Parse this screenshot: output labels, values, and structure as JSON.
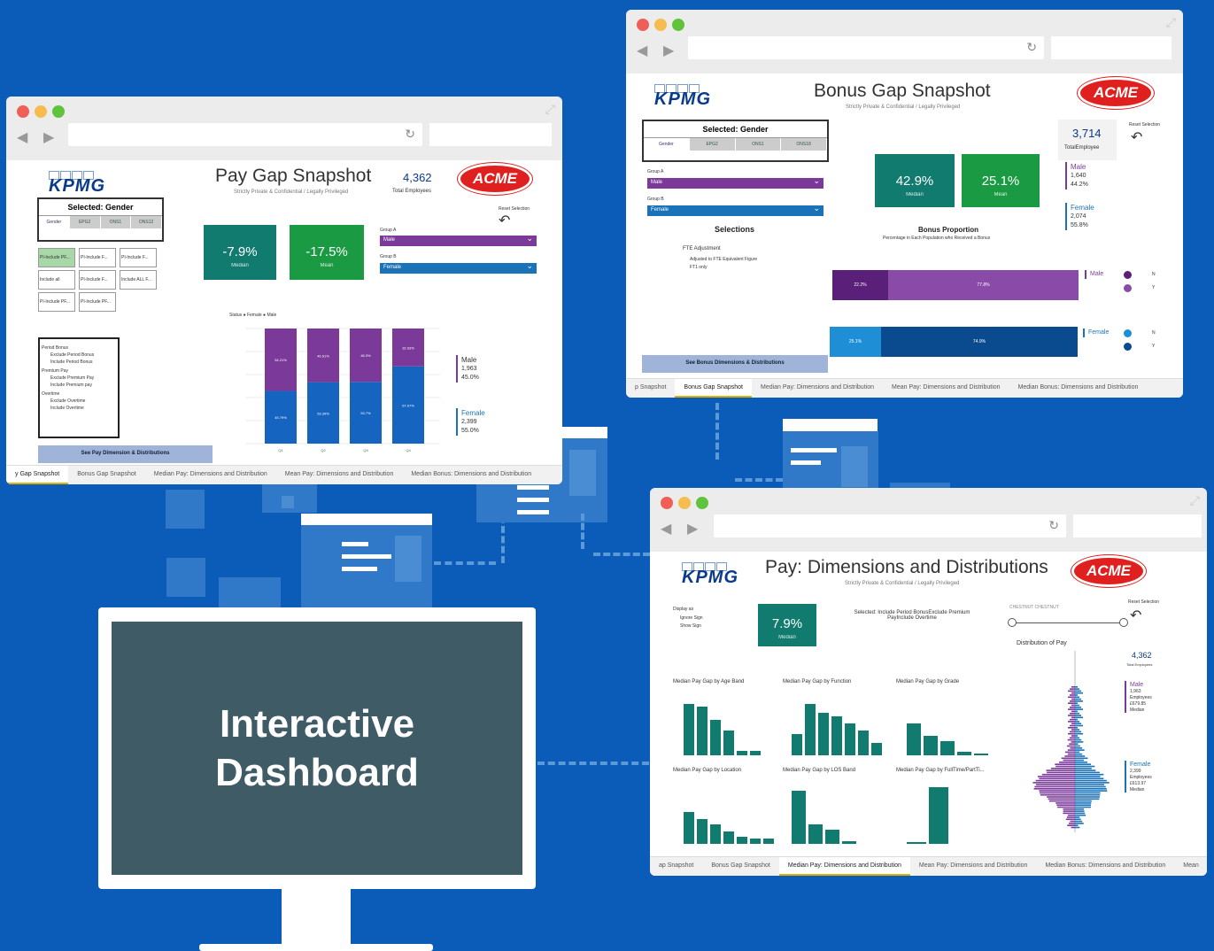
{
  "hero": {
    "line1": "Interactive",
    "line2": "Dashboard"
  },
  "tabs_pay": [
    "y Gap Snapshot",
    "Bonus Gap Snapshot",
    "Median Pay: Dimensions and Distribution",
    "Mean Pay: Dimensions and Distribution",
    "Median Bonus: Dimensions and Distribution"
  ],
  "tabs_bonus": [
    "p Snapshot",
    "Bonus Gap Snapshot",
    "Median Pay: Dimensions and Distribution",
    "Mean Pay: Dimensions and Distribution",
    "Median Bonus: Dimensions and Distribution"
  ],
  "tabs_dim": [
    "ap Snapshot",
    "Bonus Gap Snapshot",
    "Median Pay: Dimensions and Distribution",
    "Mean Pay: Dimensions and Distribution",
    "Median Bonus: Dimensions and Distribution",
    "Mean"
  ],
  "pay": {
    "logo": "KPMG",
    "brand": "ACME",
    "title": "Pay Gap Snapshot",
    "subtitle": "Strictly Private & Confidential / Legally Privileged",
    "total_value": "4,362",
    "total_label": "Total Employees",
    "reset": "Reset Selection",
    "selected": "Selected: Gender",
    "segments": [
      "Gender",
      "EPG2",
      "ONS1",
      "ONS12"
    ],
    "filters": [
      "PI-Include PF...",
      "PI-Include F...",
      "PI-Include F...",
      "Include all",
      "PI-Include F...",
      "Include ALL F...",
      "PI-Include PF...",
      "PI-Include PF..."
    ],
    "median_value": "-7.9%",
    "median_label": "Median",
    "mean_value": "-17.5%",
    "mean_label": "Mean",
    "groupA_label": "Group A",
    "groupA": "Male",
    "groupB_label": "Group B",
    "groupB": "Female",
    "options": [
      "Period Bonus",
      "Exclude Period Bonus",
      "Include Period Bonus",
      "Premium Pay",
      "Exclude Premium Pay",
      "Include Premium pay",
      "Overtime",
      "Exclude Overtime",
      "Include Overtime"
    ],
    "btn": "See Pay Dimension & Distributions",
    "legend": "Status ● Female ● Male",
    "male_label": "Male",
    "male_count": "1,963",
    "male_pct": "45.0%",
    "female_label": "Female",
    "female_count": "2,399",
    "female_pct": "55.0%"
  },
  "chart_data": {
    "type": "bar",
    "stacked": true,
    "categories": [
      "Q1",
      "Q2",
      "Q3",
      "Q4"
    ],
    "series": [
      {
        "name": "Female",
        "values": [
          45.79,
          53.39,
          53.7,
          67.07
        ],
        "labels": [
          "45.79%",
          "53.39%",
          "53.7%",
          "67.07%"
        ],
        "color": "#1565c0"
      },
      {
        "name": "Male",
        "values": [
          54.21,
          46.61,
          46.3,
          32.93
        ],
        "labels": [
          "54.21%",
          "46.61%",
          "46.3%",
          "32.93%"
        ],
        "color": "#7b3a9a"
      }
    ],
    "ylim": [
      0,
      100
    ]
  },
  "bonus": {
    "logo": "KPMG",
    "brand": "ACME",
    "title": "Bonus Gap Snapshot",
    "subtitle": "Strictly Private & Confidential / Legally Privileged",
    "total_value": "3,714",
    "total_label": "TotalEmployee",
    "reset": "Reset Selection",
    "selected": "Selected: Gender",
    "segments": [
      "Gender",
      "EPG2",
      "ONS1",
      "ONS18"
    ],
    "groupA_label": "Group A",
    "groupA": "Male",
    "groupB_label": "Group B",
    "groupB": "Female",
    "selections": "Selections",
    "fte": "FTE Adjustment",
    "fte_opt1": "Adjusted to FTE Equivalent Figure",
    "fte_opt2": "FT1 only",
    "median_value": "42.9%",
    "median_label": "Median",
    "mean_value": "25.1%",
    "mean_label": "Mean",
    "proportion_title": "Bonus Proportion",
    "proportion_sub": "Percentage in Each Population who Received a Bonus",
    "male_label": "Male",
    "male_count": "1,640",
    "male_pct": "44.2%",
    "female_label": "Female",
    "female_count": "2,074",
    "female_pct": "55.8%",
    "male_bar": [
      "22.2%",
      "77.8%"
    ],
    "female_bar": [
      "25.1%",
      "74.9%"
    ],
    "btn": "See Bonus Dimensions & Distributions",
    "legend_n": "N",
    "legend_y": "Y"
  },
  "dim": {
    "logo": "KPMG",
    "brand": "ACME",
    "title": "Pay: Dimensions and Distributions",
    "subtitle": "Strictly Private & Confidential / Legally Privileged",
    "display_as": "Display as",
    "opt1": "Ignore Sign",
    "opt2": "Show Sign",
    "median_value": "7.9%",
    "median_label": "Median",
    "selected": "Selected: Include Period BonusExclude Premium PayInclude Overtime",
    "range": "CHESTNUT CHESTNUT",
    "reset": "Reset Selection",
    "dist_title": "Distribution of Pay",
    "total_value": "4,362",
    "total_label": "Total Employees",
    "male_label": "Male",
    "male_count": "1,963",
    "male_emp": "Employees",
    "male_val": "£679.85",
    "male_med": "Median",
    "female_label": "Female",
    "female_count": "2,399",
    "female_emp": "Employees",
    "female_val": "£613.97",
    "female_med": "Median",
    "charts": [
      "Median Pay Gap by Age Band",
      "Median Pay Gap by Function",
      "Median Pay Gap by Grade",
      "Median Pay Gap by Location",
      "Median Pay Gap by LOS Band",
      "Median Pay Gap by FullTime/PartTi..."
    ]
  }
}
